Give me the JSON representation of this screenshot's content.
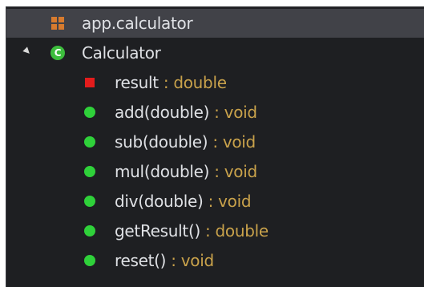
{
  "outline": {
    "package": {
      "label": "app.calculator",
      "icon": "package-icon"
    },
    "class": {
      "label": "Calculator",
      "icon": "class-icon",
      "icon_letter": "C",
      "expanded": true
    },
    "members": [
      {
        "name": "result",
        "type": " : double",
        "kind": "field",
        "icon": "field-icon"
      },
      {
        "name": "add(double)",
        "type": " : void",
        "kind": "method",
        "icon": "method-icon"
      },
      {
        "name": "sub(double)",
        "type": " : void",
        "kind": "method",
        "icon": "method-icon"
      },
      {
        "name": "mul(double)",
        "type": " : void",
        "kind": "method",
        "icon": "method-icon"
      },
      {
        "name": "div(double)",
        "type": " : void",
        "kind": "method",
        "icon": "method-icon"
      },
      {
        "name": "getResult()",
        "type": " : double",
        "kind": "method",
        "icon": "method-icon"
      },
      {
        "name": "reset()",
        "type": " : void",
        "kind": "method",
        "icon": "method-icon"
      }
    ]
  },
  "colors": {
    "background": "#1e1f22",
    "selected_row": "#414248",
    "text": "#dfe1e5",
    "type_text": "#c9a24b",
    "package_icon": "#d77b2e",
    "class_icon": "#3dbd3d",
    "field_icon": "#e41c1c",
    "method_icon": "#2fd13a"
  }
}
